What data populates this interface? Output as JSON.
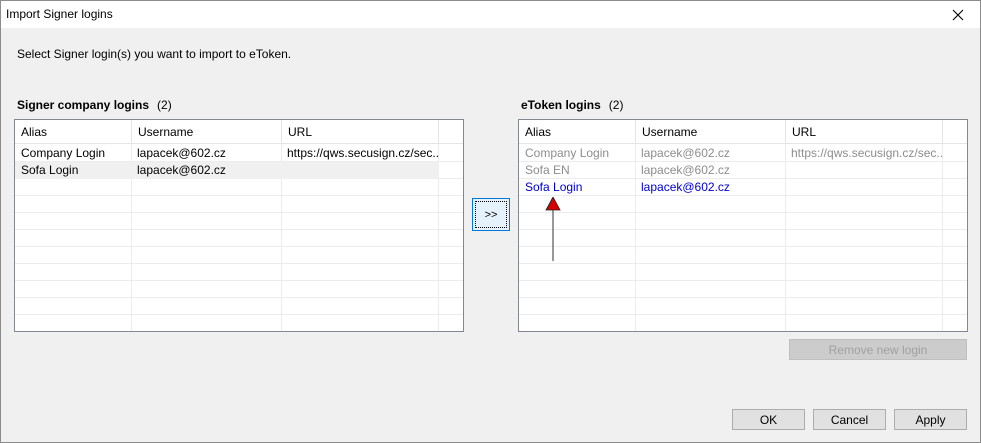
{
  "window": {
    "title": "Import Signer logins"
  },
  "instruction": "Select Signer login(s) you want to import to eToken.",
  "source": {
    "label": "Signer company logins",
    "count": "(2)",
    "columns": [
      "Alias",
      "Username",
      "URL"
    ],
    "rows": [
      {
        "alias": "Company Login",
        "username": "lapacek@602.cz",
        "url": "https://qws.secusign.cz/sec..."
      },
      {
        "alias": "Sofa Login",
        "username": "lapacek@602.cz",
        "url": ""
      }
    ]
  },
  "move_button": ">>",
  "target": {
    "label": "eToken logins",
    "count": "(2)",
    "columns": [
      "Alias",
      "Username",
      "URL"
    ],
    "rows": [
      {
        "alias": "Company Login",
        "username": "lapacek@602.cz",
        "url": "https://qws.secusign.cz/sec...",
        "state": "existing"
      },
      {
        "alias": "Sofa EN",
        "username": "lapacek@602.cz",
        "url": "",
        "state": "existing"
      },
      {
        "alias": "Sofa Login",
        "username": "lapacek@602.cz",
        "url": "",
        "state": "new"
      }
    ]
  },
  "remove_button": "Remove new login",
  "ok_button": "OK",
  "cancel_button": "Cancel",
  "apply_button": "Apply",
  "colors": {
    "existing_text": "#8d8d8d",
    "new_text": "#0000cc",
    "arrow_head": "#d40000"
  }
}
